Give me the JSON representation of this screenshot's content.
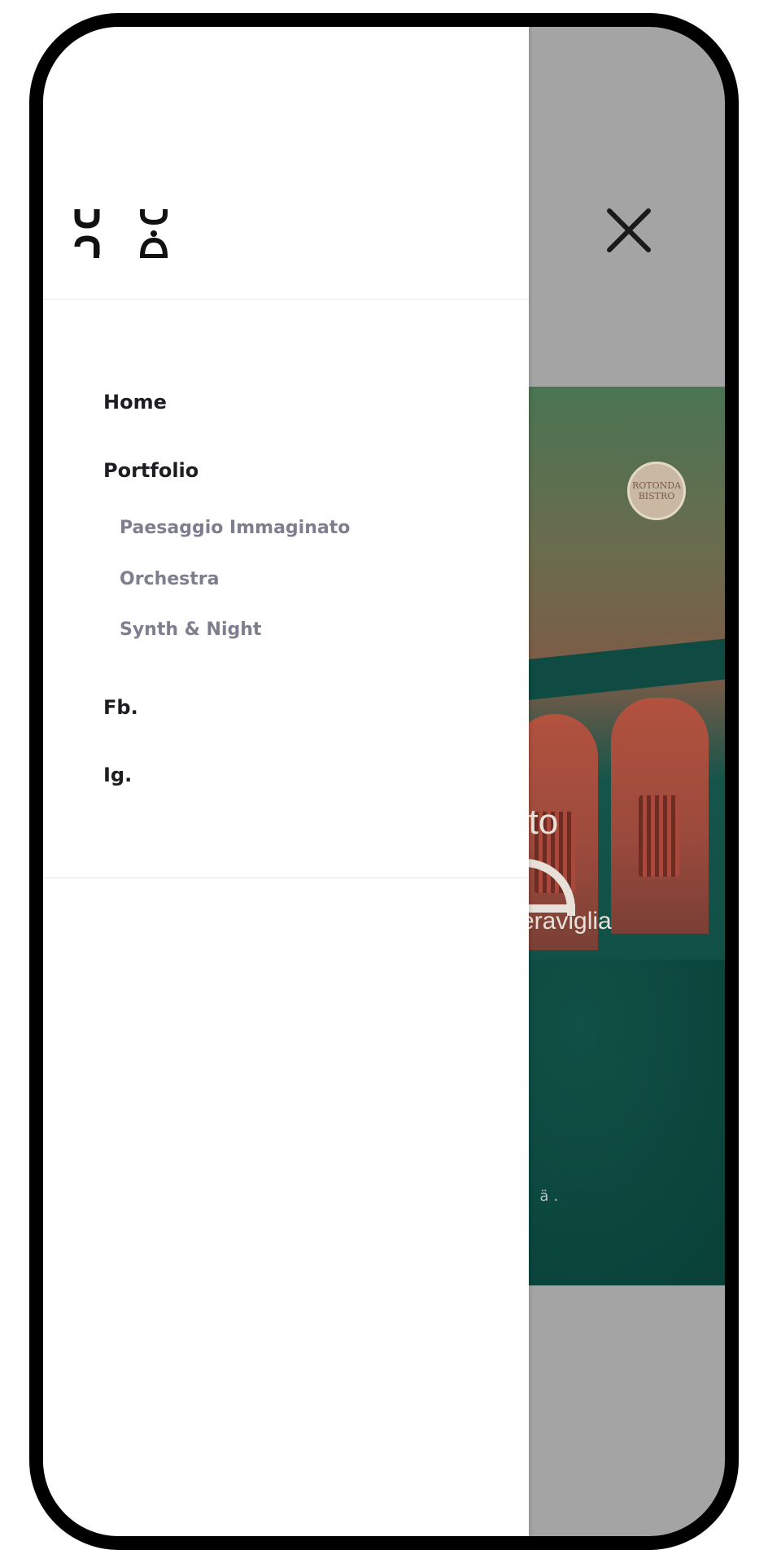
{
  "menu": {
    "items": [
      {
        "label": "Home"
      },
      {
        "label": "Portfolio",
        "children": [
          {
            "label": "Paesaggio Immaginato"
          },
          {
            "label": "Orchestra"
          },
          {
            "label": "Synth & Night"
          }
        ]
      },
      {
        "label": "Fb."
      },
      {
        "label": "Ig."
      }
    ]
  },
  "close_icon": "close-icon",
  "logo_icon": "brand-logo-icon",
  "background_hero": {
    "badge_text": "ROTONDA\nBISTRO",
    "text_line1": "ato",
    "text_line2": "meraviglia",
    "marks": "v ä."
  },
  "colors": {
    "overlay": "#a4a4a4",
    "menu_text": "#1e1e22",
    "submenu_text": "#7d7f8f",
    "divider": "#e8e8ea"
  }
}
